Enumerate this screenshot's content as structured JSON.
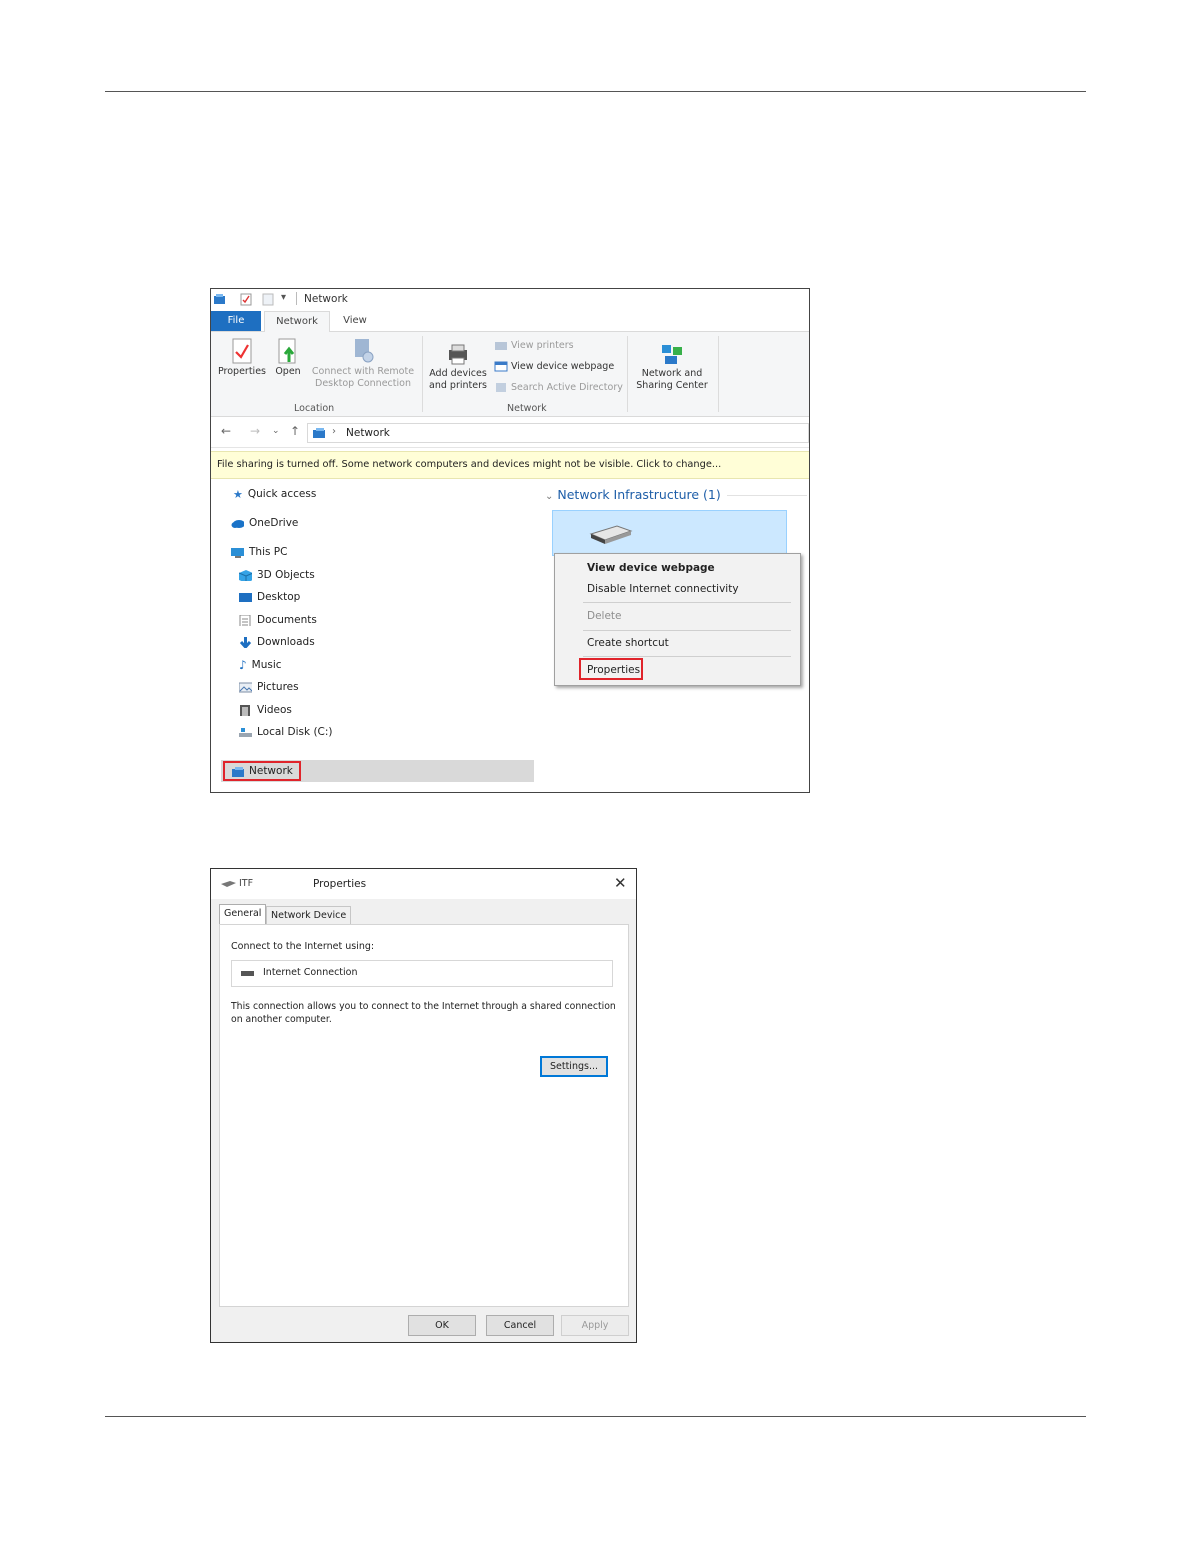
{
  "explorer": {
    "window_title": "Network",
    "tabs": {
      "file": "File",
      "network": "Network",
      "view": "View"
    },
    "ribbon": {
      "properties": "Properties",
      "open": "Open",
      "connect_remote_line1": "Connect with Remote",
      "connect_remote_line2": "Desktop Connection",
      "location_group": "Location",
      "add_devices_line1": "Add devices",
      "add_devices_line2": "and printers",
      "view_printers": "View printers",
      "view_device_webpage": "View device webpage",
      "search_active_directory": "Search Active Directory",
      "network_group": "Network",
      "sharing_center_line1": "Network and",
      "sharing_center_line2": "Sharing Center"
    },
    "address": {
      "crumb": "Network"
    },
    "infobar": "File sharing is turned off. Some network computers and devices might not be visible. Click to change...",
    "nav": {
      "quick_access": "Quick access",
      "onedrive": "OneDrive",
      "this_pc": "This PC",
      "objects_3d": "3D Objects",
      "desktop": "Desktop",
      "documents": "Documents",
      "downloads": "Downloads",
      "music": "Music",
      "pictures": "Pictures",
      "videos": "Videos",
      "local_disk": "Local Disk (C:)",
      "network": "Network"
    },
    "content": {
      "group_header": "Network Infrastructure (1)"
    },
    "context_menu": {
      "view_device_webpage": "View device webpage",
      "disable_internet": "Disable Internet connectivity",
      "delete": "Delete",
      "create_shortcut": "Create shortcut",
      "properties": "Properties"
    }
  },
  "dialog": {
    "app_name": "ITF",
    "title": "Properties",
    "tabs": {
      "general": "General",
      "network_device": "Network Device"
    },
    "connect_label": "Connect to the Internet using:",
    "connection_name": "Internet Connection",
    "description_line1": "This connection allows you to connect to the Internet through a shared connection",
    "description_line2": "on another computer.",
    "settings_button": "Settings...",
    "ok": "OK",
    "cancel": "Cancel",
    "apply": "Apply"
  },
  "colors": {
    "file_tab": "#1e6fc1",
    "highlight_box": "#e0242b",
    "selection": "#cce8ff",
    "infobar": "#fffed7",
    "group_header": "#1e5ea8"
  }
}
